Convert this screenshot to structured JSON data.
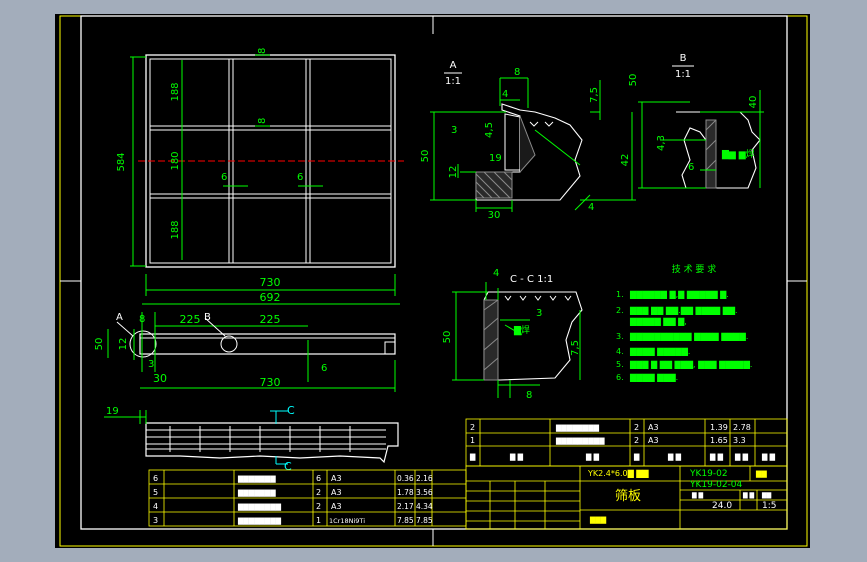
{
  "colors": {
    "background_outer": "#a3adbb",
    "sheet": "#000000",
    "line_white": "#ffffff",
    "dim_green": "#00ff00",
    "centerline_red": "#ff0000",
    "text_yellow": "#ffff00",
    "border_yellow": "#ffff00",
    "leader_cyan": "#00ffff",
    "hatch_gray": "#8a8a8a"
  },
  "front_view": {
    "dim_584": "584",
    "dim_188_top": "188",
    "dim_180_mid": "180",
    "dim_188_bottom": "188",
    "dim_8_top": "8",
    "dim_8_mid": "8",
    "dim_6_left": "6",
    "dim_6_right": "6",
    "dim_730": "730",
    "dim_692": "692"
  },
  "bottom_view": {
    "label_a": "A",
    "label_b": "B",
    "dim_8": "8",
    "dim_225_left": "225",
    "dim_225_right": "225",
    "dim_50": "50",
    "dim_12": "12",
    "dim_3": "3",
    "dim_30": "30",
    "dim_730": "730",
    "dim_6": "6"
  },
  "section_view": {
    "dim_19": "19",
    "label_c_top": "C",
    "label_c_bottom": "C"
  },
  "detail_a": {
    "title": "A",
    "scale": "1:1",
    "dim_8": "8",
    "dim_4": "4",
    "dim_7_5": "7,5",
    "dim_4_5": "4,5",
    "dim_3": "3",
    "dim_50": "50",
    "dim_19": "19",
    "dim_12": "12",
    "dim_42": "42",
    "dim_30": "30",
    "dim_4_leader": "4"
  },
  "detail_b": {
    "title": "B",
    "scale": "1:1",
    "dim_50": "50",
    "dim_40": "40",
    "dim_4_3": "4,3",
    "dim_6": "6",
    "weld_note": "▇▆ ▆焊"
  },
  "section_cc": {
    "title": "C - C  1:1",
    "dim_4": "4",
    "dim_3": "3",
    "dim_50": "50",
    "dim_7_5": "7,5",
    "dim_8": "8",
    "weld_note": "▇焊"
  },
  "tech_notes": {
    "title": "技 术 要 求",
    "items": [
      {
        "num": "1.",
        "text": "▇▇▇▇▇▇ ▇,▇ ▇▇▇▇▇ ▇."
      },
      {
        "num": "2.",
        "text": "▇▇▇ ▇▇ ▇▇.▇▇ ▇▇▇▇ ▇▇."
      },
      {
        "num": "",
        "text": "▇▇▇▇▇ ▇▇ ▇,"
      },
      {
        "num": "3.",
        "text": "▇▇▇▇▇▇▇▇▇▇   ▇▇▇▇ ▇▇▇▇."
      },
      {
        "num": "4.",
        "text": "▇▇▇▇ ▇▇▇▇▇."
      },
      {
        "num": "5.",
        "text": "▇▇▇ ▇ ▇▇ ▇▇▇,   ▇▇▇ ▇▇▇▇▇."
      },
      {
        "num": "6.",
        "text": "▇▇▇▇ ▇▇▇."
      }
    ]
  },
  "upper_bom": {
    "rows": [
      {
        "idx": "2",
        "name": "▇▇▇▇▇▇▇▇",
        "qty": "2",
        "mat": "A3",
        "unit": "1.39",
        "total": "2.78"
      },
      {
        "idx": "1",
        "name": "▇▇▇▇▇▇▇▇▇",
        "qty": "2",
        "mat": "A3",
        "unit": "1.65",
        "total": "3.3"
      }
    ],
    "header": {
      "c1": "▇",
      "c2": "▇ ▇",
      "c3": "▇ ▇",
      "c4": "▇",
      "c5": "▇ ▇",
      "c6": "▇ ▇",
      "c7": "▇ ▇",
      "c8": "▇ ▇"
    }
  },
  "lower_bom": {
    "rows": [
      {
        "idx": "6",
        "name": "▇▇▇▇▇▇▇",
        "qty": "6",
        "mat": "A3",
        "unit": "0.36",
        "total": "2.16"
      },
      {
        "idx": "5",
        "name": "▇▇▇▇▇▇▇",
        "qty": "2",
        "mat": "A3",
        "unit": "1.78",
        "total": "3.56"
      },
      {
        "idx": "4",
        "name": "▇▇▇▇▇▇▇▇",
        "qty": "2",
        "mat": "A3",
        "unit": "2.17",
        "total": "4.34"
      },
      {
        "idx": "3",
        "name": "▇▇▇▇▇▇▇▇",
        "qty": "1",
        "mat": "1Cr18Ni9Ti",
        "unit": "7.85",
        "total": "7.85"
      }
    ]
  },
  "title_block": {
    "project": "YK2.4*6.0▇ ▇▇",
    "code_top": "YK19-02",
    "code_main": "YK19-02-04",
    "part_name": "筛板",
    "sub_label": "▇▇▇",
    "weight": "24.0",
    "scale": "1:5",
    "mark": "▇▇",
    "label_weight": "▇ ▇",
    "label_scale": "▇ ▇",
    "label_grade": "▇▇"
  }
}
